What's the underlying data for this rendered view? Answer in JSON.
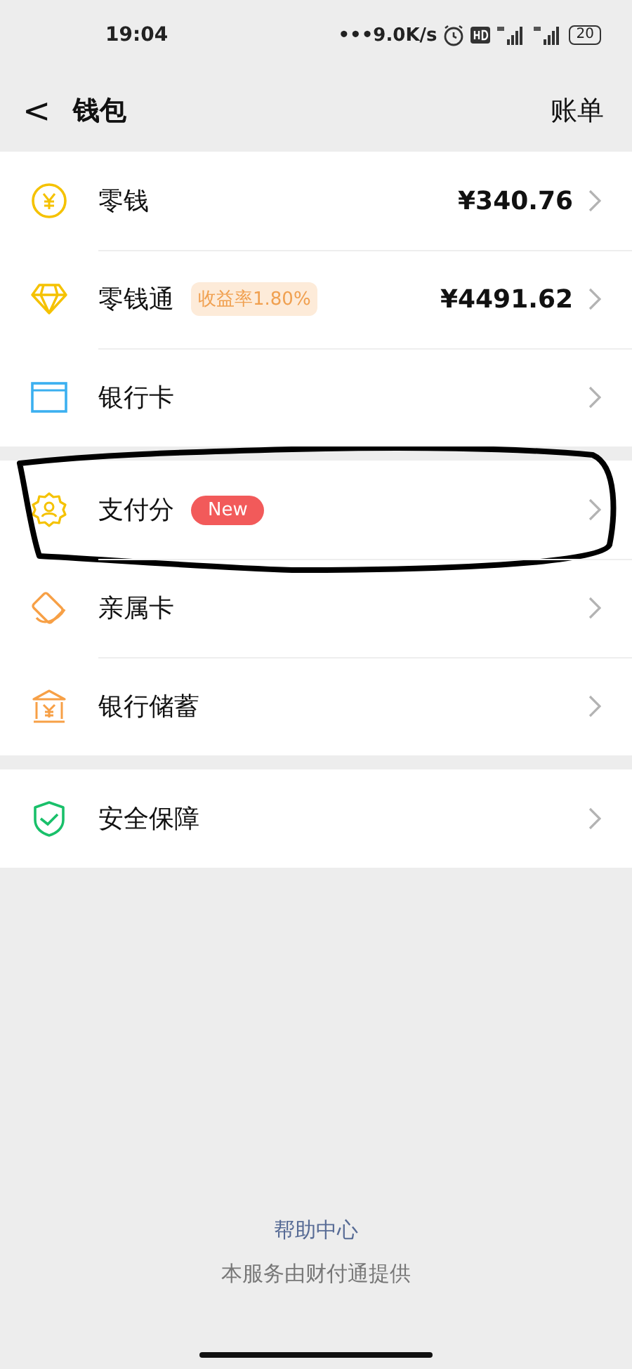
{
  "status_bar": {
    "time": "19:04",
    "speed": "•••9.0K/s",
    "battery": "20"
  },
  "header": {
    "back": "<",
    "title": "钱包",
    "action": "账单"
  },
  "sections": [
    {
      "items": [
        {
          "label": "零钱",
          "value": "¥340.76"
        },
        {
          "label": "零钱通",
          "tag": {
            "kind": "rate",
            "text": "收益率1.80%"
          },
          "value": "¥4491.62"
        },
        {
          "label": "银行卡"
        }
      ]
    },
    {
      "items": [
        {
          "label": "支付分",
          "tag": {
            "kind": "new",
            "text": "New"
          },
          "circled": true
        },
        {
          "label": "亲属卡"
        },
        {
          "label": "银行储蓄"
        }
      ]
    },
    {
      "items": [
        {
          "label": "安全保障"
        }
      ]
    }
  ],
  "footer": {
    "link": "帮助中心",
    "note": "本服务由财付通提供"
  }
}
